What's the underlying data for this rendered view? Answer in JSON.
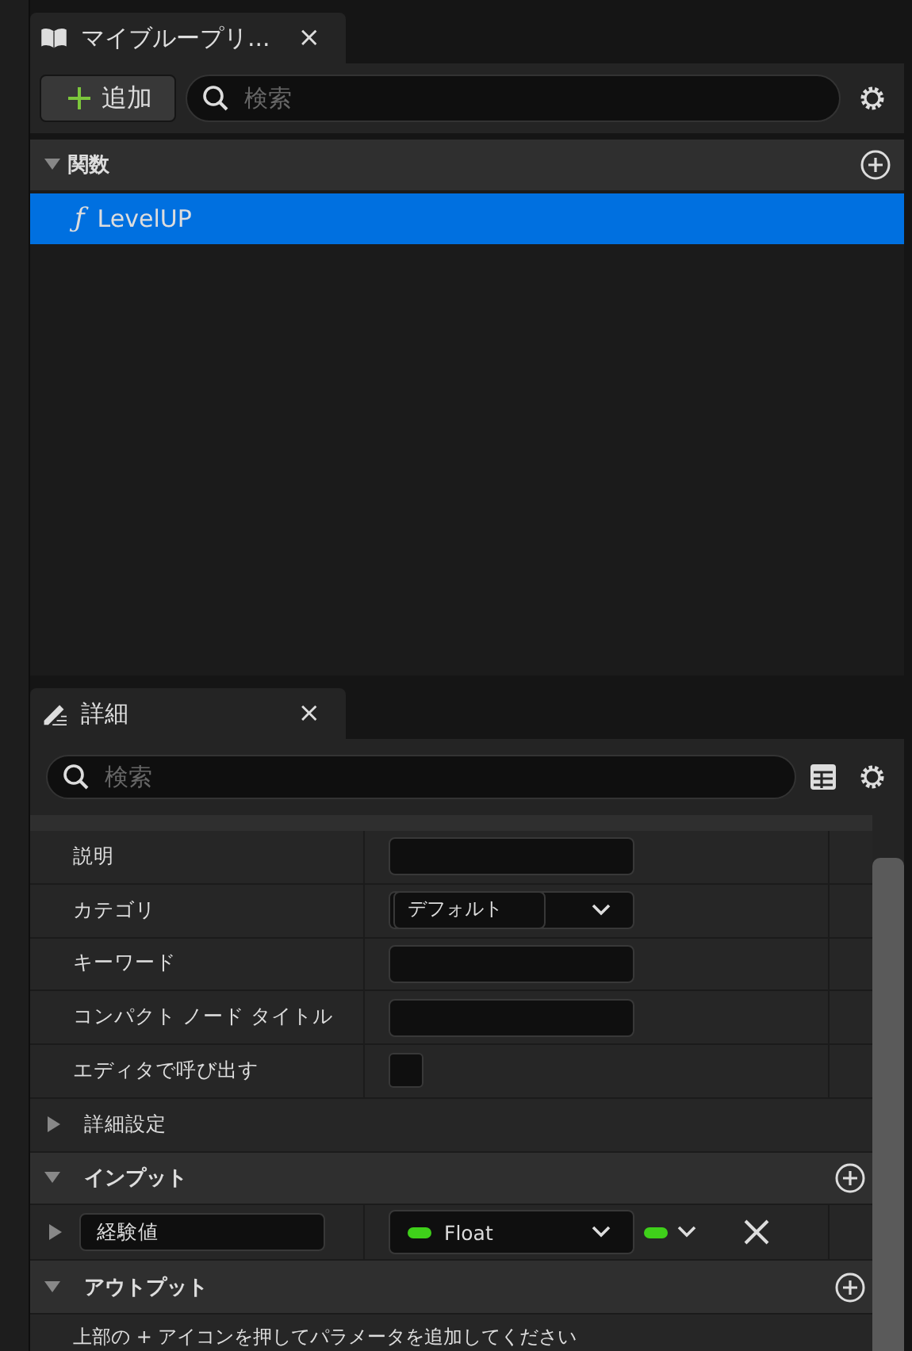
{
  "blueprint_panel": {
    "tab": {
      "title": "マイブループリ...",
      "close": "×"
    },
    "add_button": "追加",
    "search": {
      "placeholder": "検索"
    },
    "sections": [
      {
        "title": "関数",
        "expanded": true,
        "items": [
          {
            "icon": "ƒ",
            "label": "LevelUP",
            "selected": true
          }
        ]
      }
    ]
  },
  "details_panel": {
    "tab": {
      "title": "詳細",
      "close": "×"
    },
    "search": {
      "placeholder": "検索"
    },
    "properties": [
      {
        "label": "説明",
        "kind": "text"
      },
      {
        "label": "カテゴリ",
        "kind": "dropdown",
        "value": "デフォルト"
      },
      {
        "label": "キーワード",
        "kind": "text"
      },
      {
        "label": "コンパクト ノード タイトル",
        "kind": "text"
      },
      {
        "label": "エディタで呼び出す",
        "kind": "checkbox",
        "checked": false
      }
    ],
    "advanced": {
      "label": "詳細設定",
      "expanded": false
    },
    "inputs": {
      "title": "インプット",
      "expanded": true,
      "params": [
        {
          "name": "経験値",
          "type": "Float",
          "color": "#3fd01a",
          "expanded": false
        }
      ]
    },
    "outputs": {
      "title": "アウトプット",
      "expanded": true,
      "hint": "上部の + アイコンを押してパラメータを追加してください"
    }
  }
}
